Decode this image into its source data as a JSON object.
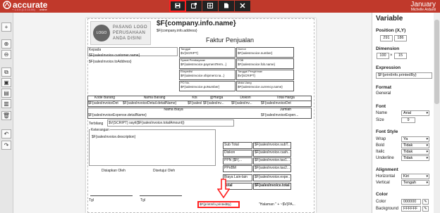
{
  "app": {
    "name": "accurate",
    "sub": "+ 1.0.5 (1.0.13.55)",
    "online": "online",
    "month": "January",
    "user": "Michelle Ardanti"
  },
  "toolbar": {
    "save": "save-icon",
    "export": "export-icon",
    "center": "move-icon",
    "doc": "document-icon",
    "close": "close-icon"
  },
  "left": {
    "items": [
      "+",
      "⊕",
      "⊖",
      "⧉",
      "▣",
      "▤",
      "▥",
      "🗑",
      "↶",
      "↷"
    ]
  },
  "paper": {
    "logo_box": "LOGO",
    "logo_text": [
      "PASANG LOGO",
      "PERUSAHAAN",
      "ANDA DISINI"
    ],
    "company": "$F{company.info.name}",
    "address": "$F{company.info.address}",
    "title": "Faktur Penjualan",
    "kepada": "Kepada",
    "customer": "$F{salesInvoice.customer.name}",
    "toaddress": "$F{salesInvoice.toAddress}",
    "fields": [
      {
        "label": "Tanggal",
        "value": "$V{SCRIPT}"
      },
      {
        "label": "Nomor",
        "value": "$F{salesInvoice.number}"
      },
      {
        "label": "Syarat Pembayaran",
        "value": "$F{salesInvoice.paymentTerm...}"
      },
      {
        "label": "FOB",
        "value": "$F{salesInvoice.fob.name}"
      },
      {
        "label": "Ekspedisi",
        "value": "$F{salesInvoice.shipment.na...}"
      },
      {
        "label": "Tanggal Pengiriman",
        "value": "$V{SCRIPT}"
      },
      {
        "label": "PO No.",
        "value": "$F{salesInvoice.poNumber}"
      },
      {
        "label": "Mata Uang",
        "value": "$F{salesInvoice.currency.name}"
      }
    ],
    "table_headers": [
      "Kode Barang",
      "Nama Barang",
      "Kts",
      "@Harga",
      "Diskon",
      "Total Harga"
    ],
    "table_cells": [
      "$F{salesInvoiceDet",
      "$F{salesInvoiceDetail.detailName}",
      "$F{salesIn...",
      "$F{salesInv...",
      "$F{salesInv...",
      "$F{salesInvoiceDet"
    ],
    "biaya_header": "Nama Biaya",
    "jumlah_header": "Jumlah",
    "biaya_cell": "$F{salesInvoiceExpense.detailName}",
    "jumlah_cell": "$F{salesInvoiceExpen...",
    "terbilang": "Terbilang",
    "terbilang_value": "$V{SCRIPT} sayit($F{salesInvoice.totalAmount})",
    "keterangan": "Keterangan",
    "desc": "$F{salesInvoice.description}",
    "totals": [
      {
        "label": "Sub Total",
        "value": "$F{salesInvoice.subT..."
      },
      {
        "label": "Diskon",
        "value": "$F{salesInvoice.cash..."
      },
      {
        "label": "PPN ($F{...",
        "value": "$F{salesInvoice.tax1..."
      },
      {
        "label": "PPnBM",
        "value": "$F{salesInvoice.tax2..."
      },
      {
        "label": "Biaya Lain-lain",
        "value": "$F{salesInvoice.expe..."
      },
      {
        "label": "Total",
        "value": "$F{salesInvoice.total..."
      }
    ],
    "sig1": "Disiapkan Oleh",
    "sig2": "Disetujui Oleh",
    "tgl1": "Tgl",
    "tgl2": "Tgl",
    "printed_by": "$F{printInfo.printedBy}",
    "page": "\"Halaman \" + ~$V{PA..."
  },
  "panel": {
    "title": "Variable",
    "pos_label": "Position (X,Y)",
    "pos_x": "291",
    "pos_y": "186",
    "dim_label": "Dimension",
    "dim_w": "100",
    "dim_h": "15",
    "expr_label": "Expression",
    "expr_value": "$F{printInfo.printedBy}",
    "format_label": "Format",
    "format_value": "General",
    "font_label": "Font",
    "name_label": "Name",
    "name_value": "Arial",
    "size_label": "Size",
    "size_value": "9",
    "fontstyle_label": "Font Style",
    "wrap_label": "Wrap",
    "wrap_value": "Ya",
    "bold_label": "Bold",
    "bold_value": "Tidak",
    "italic_label": "Italic",
    "italic_value": "Tidak",
    "underline_label": "Underline",
    "underline_value": "Tidak",
    "align_label": "Alignment",
    "horiz_label": "Horizontal",
    "horiz_value": "Kiri",
    "vert_label": "Vertical",
    "vert_value": "Tengah",
    "color_label": "Color",
    "color_sub": "Color",
    "color_value": "000000",
    "bg_label": "Background",
    "bg_value": "FFFFFF"
  },
  "colors": {
    "brand": "#c0392b",
    "highlight": "#ff2020"
  }
}
